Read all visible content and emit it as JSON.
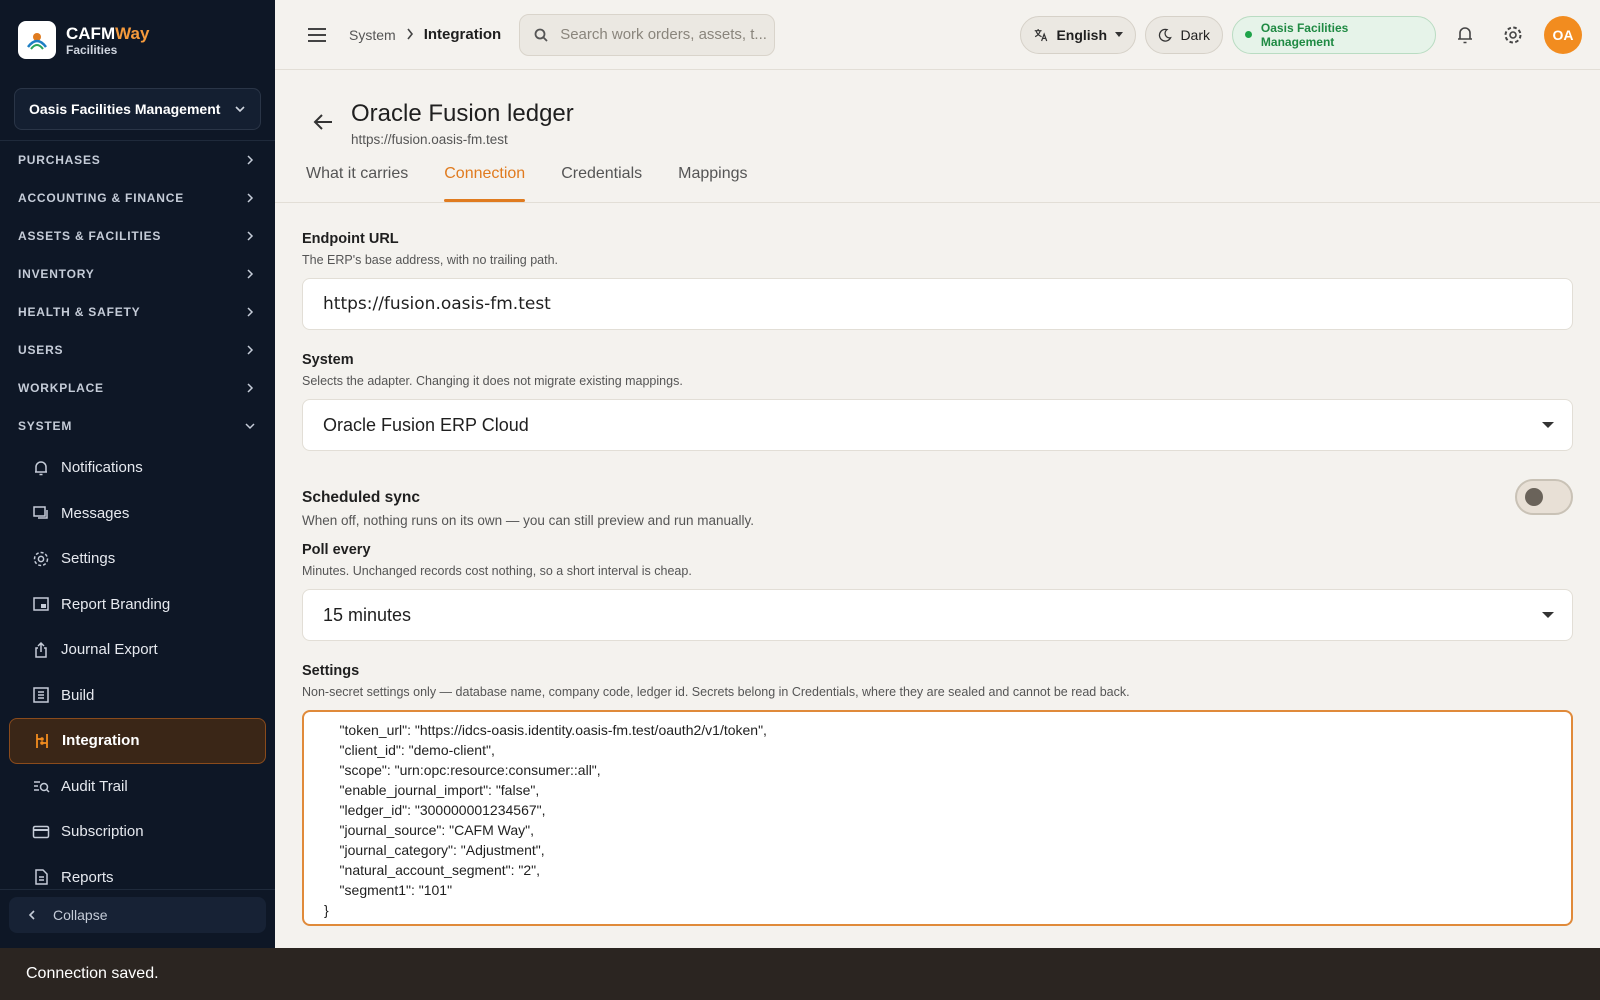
{
  "brand": {
    "name_main": "CAFM",
    "name_accent": "Way",
    "sub": "Facilities"
  },
  "sidebar": {
    "org": "Oasis Facilities Management",
    "sections": [
      "PURCHASES",
      "ACCOUNTING & FINANCE",
      "ASSETS & FACILITIES",
      "INVENTORY",
      "HEALTH & SAFETY",
      "USERS",
      "WORKPLACE",
      "SYSTEM"
    ],
    "items": [
      {
        "label": "Notifications",
        "icon": "bell-icon"
      },
      {
        "label": "Messages",
        "icon": "chat-icon"
      },
      {
        "label": "Settings",
        "icon": "gear-icon"
      },
      {
        "label": "Report Branding",
        "icon": "branding-icon"
      },
      {
        "label": "Journal Export",
        "icon": "export-icon"
      },
      {
        "label": "Build",
        "icon": "build-icon"
      },
      {
        "label": "Integration",
        "icon": "integration-icon",
        "active": true
      },
      {
        "label": "Audit Trail",
        "icon": "audit-icon"
      },
      {
        "label": "Subscription",
        "icon": "card-icon"
      },
      {
        "label": "Reports",
        "icon": "report-icon"
      }
    ],
    "collapse": "Collapse"
  },
  "topbar": {
    "breadcrumb": [
      "System",
      "Integration"
    ],
    "search_placeholder": "Search work orders, assets, t...",
    "language": "English",
    "theme": "Dark",
    "org_badge": "Oasis Facilities Management",
    "avatar": "OA"
  },
  "header": {
    "title": "Oracle Fusion ledger",
    "subtitle": "https://fusion.oasis-fm.test",
    "tabs": [
      "What it carries",
      "Connection",
      "Credentials",
      "Mappings"
    ],
    "active_tab": "Connection"
  },
  "form": {
    "endpoint": {
      "label": "Endpoint URL",
      "help": "The ERP's base address, with no trailing path.",
      "value": "https://fusion.oasis-fm.test"
    },
    "system": {
      "label": "System",
      "help": "Selects the adapter. Changing it does not migrate existing mappings.",
      "value": "Oracle Fusion ERP Cloud"
    },
    "sync": {
      "label": "Scheduled sync",
      "help": "When off, nothing runs on its own — you can still preview and run manually.",
      "enabled": false
    },
    "poll": {
      "label": "Poll every",
      "help": "Minutes. Unchanged records cost nothing, so a short interval is cheap.",
      "value": "15 minutes"
    },
    "settings": {
      "label": "Settings",
      "help": "Non-secret settings only — database name, company code, ledger id. Secrets belong in Credentials, where they are sealed and cannot be read back.",
      "value": "    \"token_url\": \"https://idcs-oasis.identity.oasis-fm.test/oauth2/v1/token\",\n    \"client_id\": \"demo-client\",\n    \"scope\": \"urn:opc:resource:consumer::all\",\n    \"enable_journal_import\": \"false\",\n    \"ledger_id\": \"300000001234567\",\n    \"journal_source\": \"CAFM Way\",\n    \"journal_category\": \"Adjustment\",\n    \"natural_account_segment\": \"2\",\n    \"segment1\": \"101\"\n}"
    }
  },
  "snackbar": "Connection saved.",
  "colors": {
    "accent": "#e07b1f",
    "sidebar_bg": "#0e1726",
    "success": "#1f8a43"
  }
}
